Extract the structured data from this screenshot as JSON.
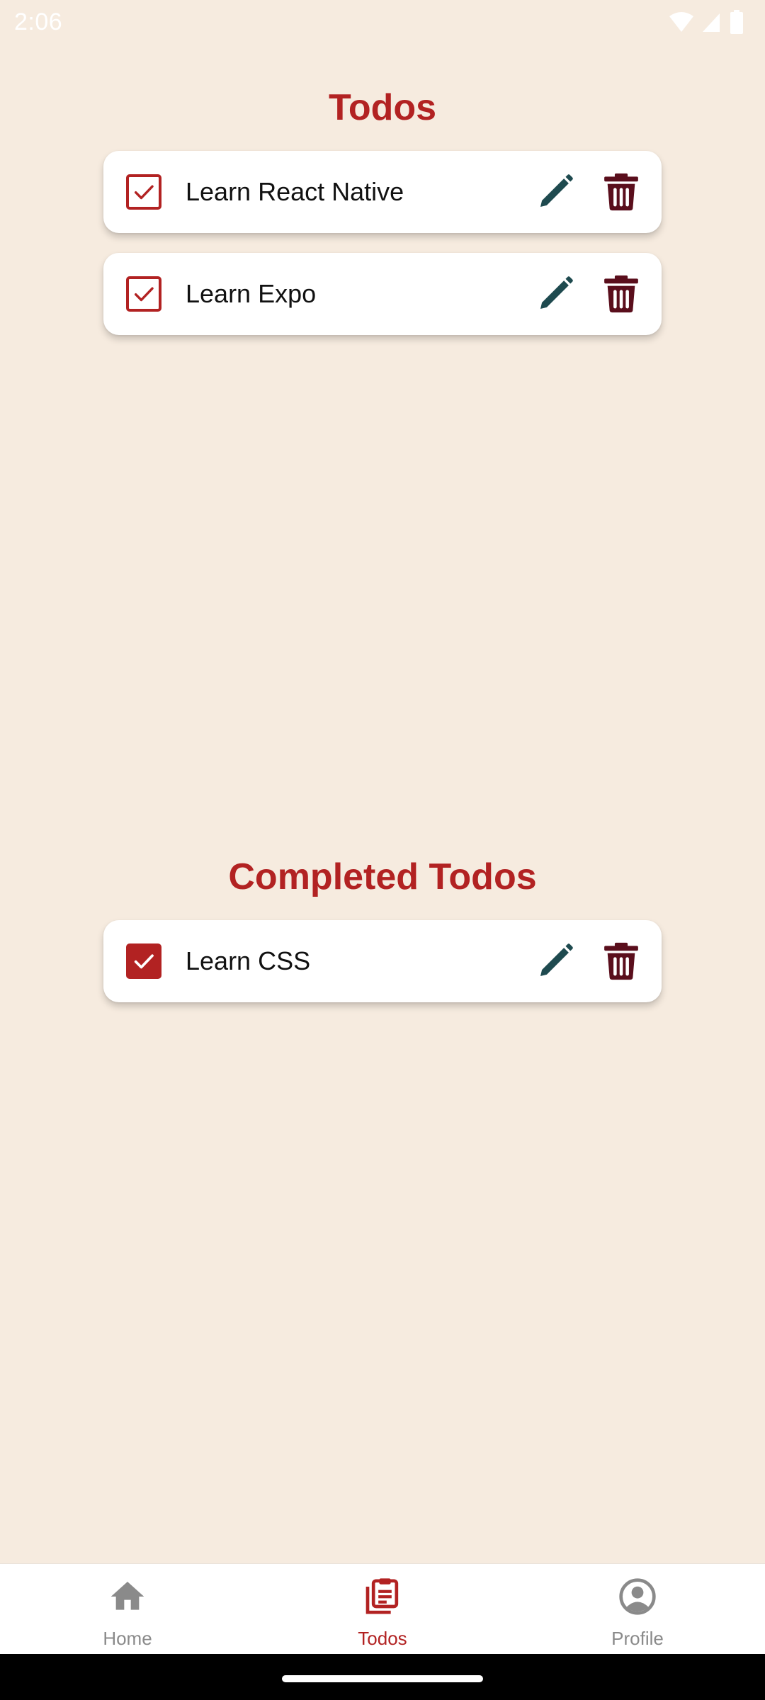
{
  "status_bar": {
    "time": "2:06"
  },
  "todos_section": {
    "title": "Todos",
    "items": [
      {
        "label": "Learn React Native",
        "completed": false
      },
      {
        "label": "Learn Expo",
        "completed": false
      }
    ]
  },
  "completed_section": {
    "title": "Completed Todos",
    "items": [
      {
        "label": "Learn CSS",
        "completed": true
      }
    ]
  },
  "bottom_nav": {
    "items": [
      {
        "label": "Home",
        "icon": "home-icon",
        "active": false
      },
      {
        "label": "Todos",
        "icon": "clipboard-list-icon",
        "active": true
      },
      {
        "label": "Profile",
        "icon": "account-circle-icon",
        "active": false
      }
    ]
  },
  "colors": {
    "background": "#F6EBDF",
    "accent": "#B22222",
    "edit_icon": "#1E4A4F",
    "delete_icon": "#5A0E1C",
    "nav_inactive": "#8A8A8A"
  }
}
